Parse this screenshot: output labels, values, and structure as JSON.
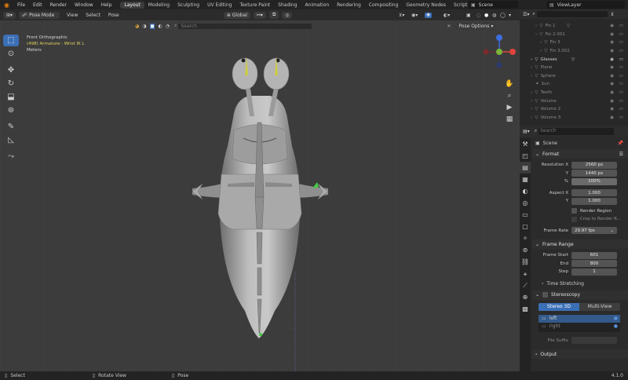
{
  "menubar": {
    "items": [
      "File",
      "Edit",
      "Render",
      "Window",
      "Help"
    ],
    "workspaces": [
      "Layout",
      "Modeling",
      "Sculpting",
      "UV Editing",
      "Texture Paint",
      "Shading",
      "Animation",
      "Rendering",
      "Compositing",
      "Geometry Nodes",
      "Scripting"
    ],
    "active_workspace": "Layout",
    "add_tab": "+",
    "scene": "Scene",
    "view_layer": "ViewLayer"
  },
  "viewport_header": {
    "mode": "Pose Mode",
    "menus": [
      "View",
      "Select",
      "Pose"
    ],
    "transform_orientation": "Global",
    "pose_options": "Pose Options",
    "search_placeholder": "Search"
  },
  "viewport_info": {
    "line1": "Front Orthographic",
    "line2": "(498) Armature : Wrist IK L",
    "line3": "Meters"
  },
  "outliner": {
    "search_placeholder": "",
    "items": [
      {
        "name": "Fin 1",
        "dim": true
      },
      {
        "name": "Fin 2.001",
        "dim": true
      },
      {
        "name": "Fin 3",
        "dim": true
      },
      {
        "name": "Fin 3.002",
        "dim": true
      },
      {
        "name": "Glasses",
        "dim": false
      },
      {
        "name": "Plane",
        "dim": true
      },
      {
        "name": "Sphere",
        "dim": true
      },
      {
        "name": "Sun",
        "dim": true
      },
      {
        "name": "Teeth",
        "dim": true
      },
      {
        "name": "Volume",
        "dim": true
      },
      {
        "name": "Volume 2",
        "dim": true
      },
      {
        "name": "Volume 3",
        "dim": true
      }
    ]
  },
  "properties": {
    "search_placeholder": "Search",
    "breadcrumb": "Scene",
    "format_section": "Format",
    "resolution_x_label": "Resolution X",
    "resolution_x": "2560 px",
    "y_label": "Y",
    "resolution_y": "1440 px",
    "percent_label": "%",
    "percent": "100%",
    "aspect_x_label": "Aspect X",
    "aspect_x": "1.000",
    "aspect_y": "1.000",
    "render_region": "Render Region",
    "crop_region": "Crop to Render R...",
    "frame_rate_label": "Frame Rate",
    "frame_rate": "29.97 fps",
    "frame_range_section": "Frame Range",
    "frame_start_label": "Frame Start",
    "frame_start": "601",
    "end_label": "End",
    "frame_end": "800",
    "step_label": "Step",
    "step": "1",
    "time_stretching": "Time Stretching",
    "stereoscopy_section": "Stereoscopy",
    "stereo_3d": "Stereo 3D",
    "multi_view": "Multi-View",
    "left": "left",
    "right": "right",
    "file_suffix": "File Suffix",
    "output_section": "Output"
  },
  "statusbar": {
    "select": "Select",
    "rotate_view": "Rotate View",
    "pose": "Pose",
    "version": "4.1.0"
  },
  "colors": {
    "accent": "#3b6fb6",
    "x_axis": "#e0443c",
    "y_axis": "#7cb33a",
    "z_axis": "#3c6ee0"
  }
}
